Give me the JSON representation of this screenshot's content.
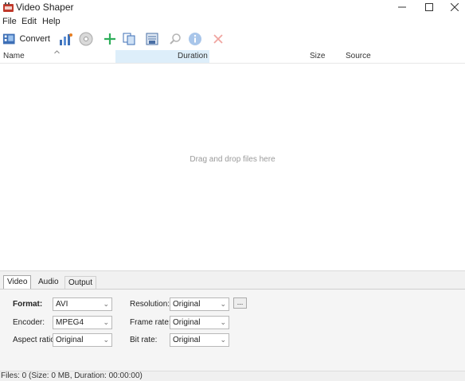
{
  "window": {
    "title": "Video Shaper"
  },
  "menu": [
    "File",
    "Edit",
    "Help"
  ],
  "toolbar": {
    "convert_label": "Convert"
  },
  "list": {
    "columns": {
      "name": "Name",
      "duration": "Duration",
      "size": "Size",
      "source": "Source"
    },
    "empty_hint": "Drag and drop files here"
  },
  "tabs": [
    "Video",
    "Audio",
    "Output"
  ],
  "settings": {
    "format_label": "Format:",
    "format_value": "AVI",
    "encoder_label": "Encoder:",
    "encoder_value": "MPEG4",
    "aspect_label": "Aspect ratio:",
    "aspect_value": "Original",
    "resolution_label": "Resolution:",
    "resolution_value": "Original",
    "framerate_label": "Frame rate:",
    "framerate_value": "Original",
    "bitrate_label": "Bit rate:",
    "bitrate_value": "Original",
    "more_label": "..."
  },
  "status": "Files: 0 (Size: 0 MB, Duration: 00:00:00)"
}
